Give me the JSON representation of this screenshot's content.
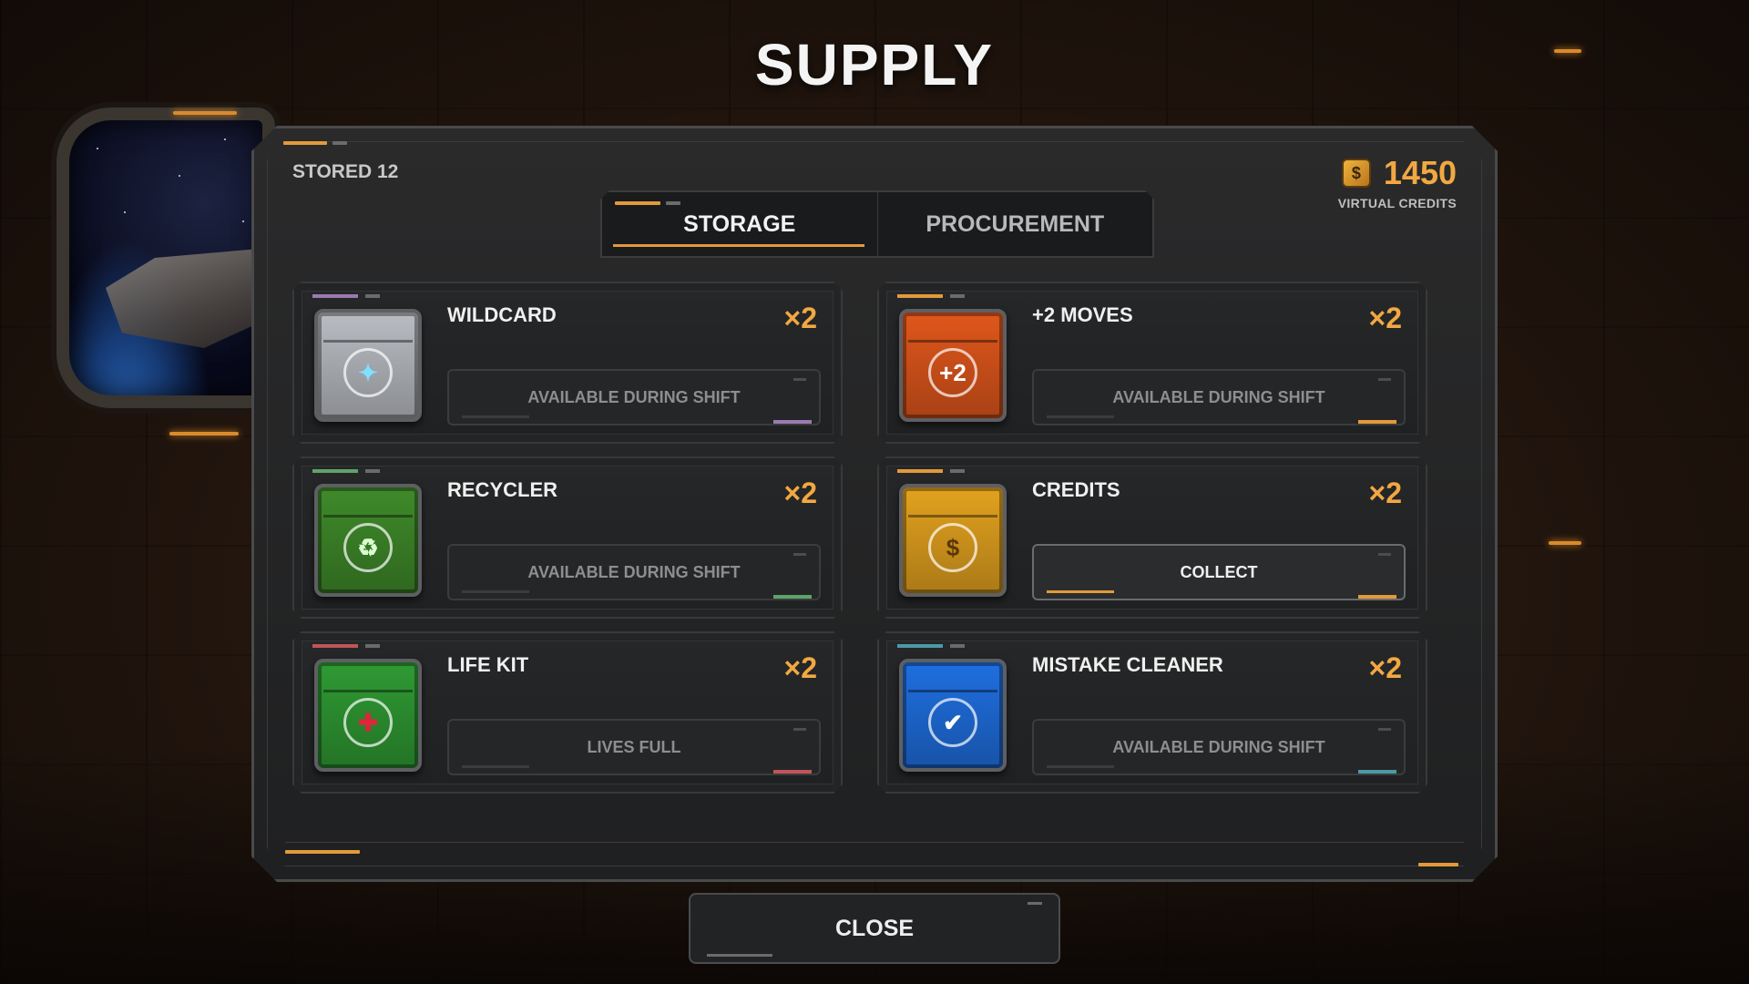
{
  "title": "SUPPLY",
  "stored_label": "STORED 12",
  "credits": {
    "amount": "1450",
    "label": "VIRTUAL CREDITS",
    "icon": "coin-icon",
    "icon_glyph": "$"
  },
  "tabs": [
    {
      "label": "STORAGE",
      "active": true
    },
    {
      "label": "PROCUREMENT",
      "active": false
    }
  ],
  "items": [
    {
      "name": "WILDCARD",
      "qty": "×2",
      "button": "AVAILABLE DURING SHIFT",
      "enabled": false,
      "accent": "#9b7ab0",
      "chest_color": "#b9bcc2",
      "emblem_glyph": "✦",
      "emblem_color": "#7de1ff"
    },
    {
      "name": "+2 MOVES",
      "qty": "×2",
      "button": "AVAILABLE DURING SHIFT",
      "enabled": false,
      "accent": "#e29a3b",
      "chest_color": "#e0571c",
      "emblem_glyph": "+2",
      "emblem_color": "#ffffff"
    },
    {
      "name": "RECYCLER",
      "qty": "×2",
      "button": "AVAILABLE DURING SHIFT",
      "enabled": false,
      "accent": "#5fa36a",
      "chest_color": "#3f8a2a",
      "emblem_glyph": "♻",
      "emblem_color": "#d9ffd0"
    },
    {
      "name": "CREDITS",
      "qty": "×2",
      "button": "COLLECT",
      "enabled": true,
      "accent": "#e29a3b",
      "chest_color": "#e3a21f",
      "emblem_glyph": "$",
      "emblem_color": "#5a3608"
    },
    {
      "name": "LIFE KIT",
      "qty": "×2",
      "button": "LIVES FULL",
      "enabled": false,
      "accent": "#c0555a",
      "chest_color": "#2f9a33",
      "emblem_glyph": "✚",
      "emblem_color": "#e0243a"
    },
    {
      "name": "MISTAKE CLEANER",
      "qty": "×2",
      "button": "AVAILABLE DURING SHIFT",
      "enabled": false,
      "accent": "#4a9aa8",
      "chest_color": "#1f6fe0",
      "emblem_glyph": "✔",
      "emblem_color": "#ffffff"
    }
  ],
  "close_label": "CLOSE"
}
